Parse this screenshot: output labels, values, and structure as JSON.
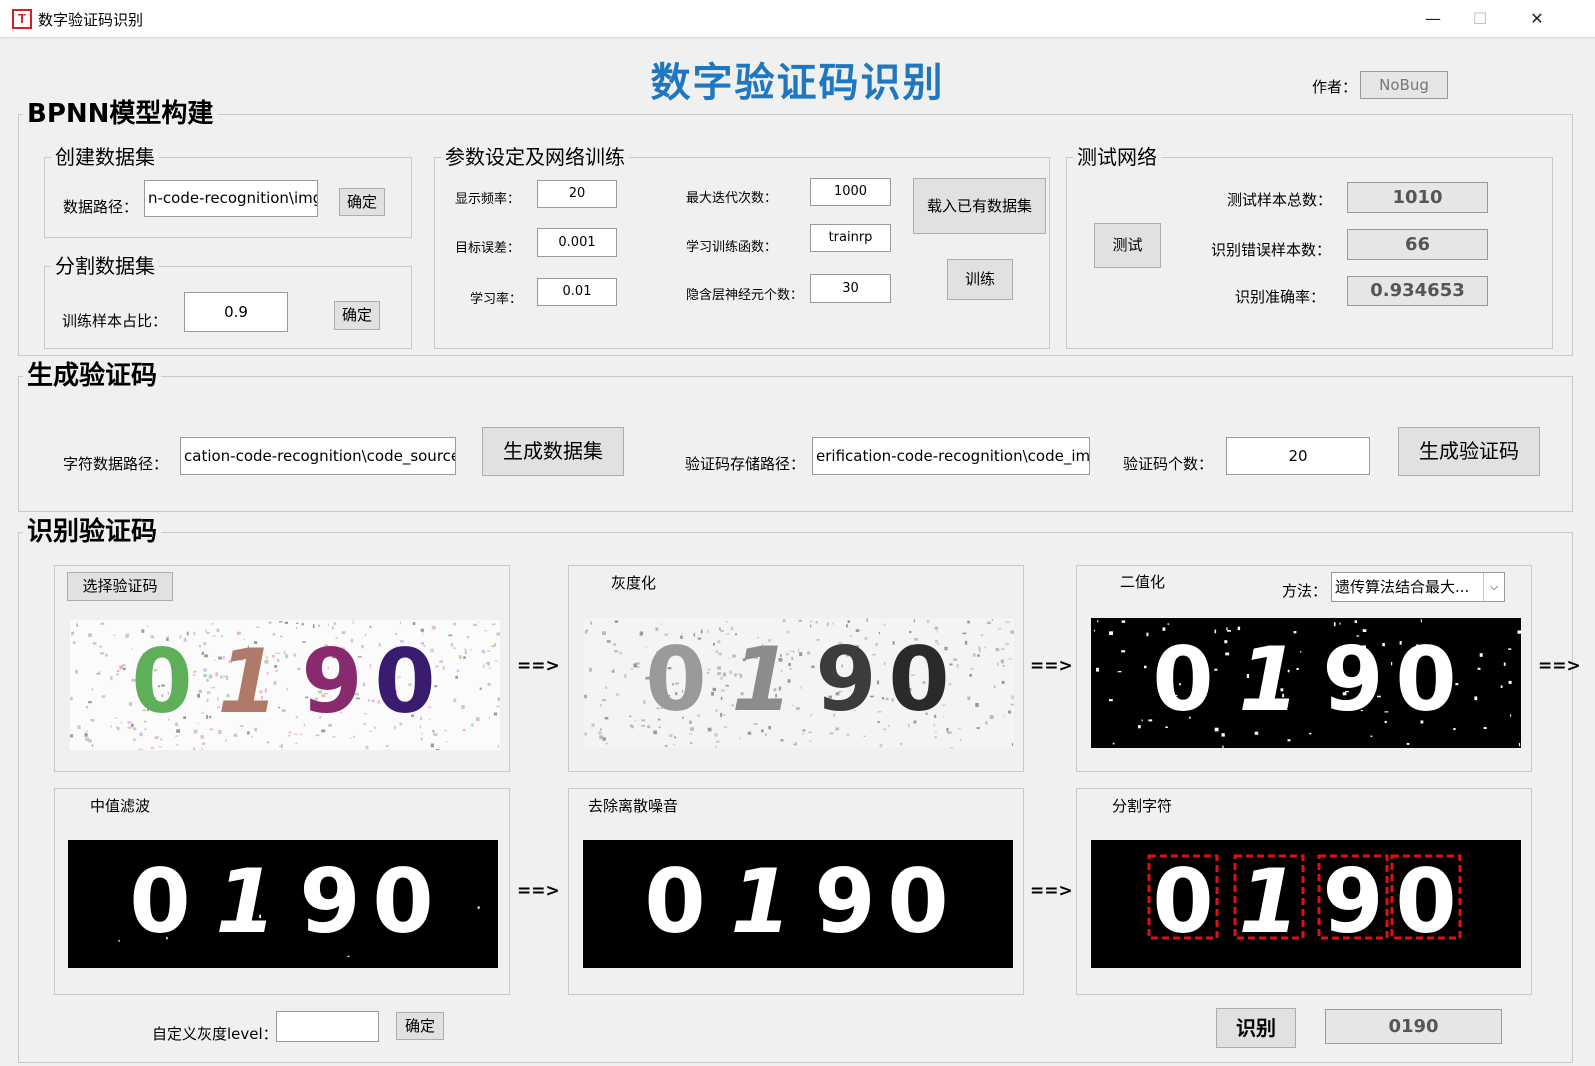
{
  "window": {
    "icon_letter": "T",
    "title": "数字验证码识别",
    "minimize_glyph": "—",
    "maximize_glyph": "☐",
    "close_glyph": "✕"
  },
  "header": {
    "title": "数字验证码识别",
    "author_label": "作者：",
    "author_value": "NoBug"
  },
  "bpnn": {
    "legend": "BPNN模型构建",
    "create_dataset": {
      "legend": "创建数据集",
      "path_label": "数据路径：",
      "path_value": "n-code-recognition\\img\\",
      "confirm": "确定"
    },
    "split_dataset": {
      "legend": "分割数据集",
      "ratio_label": "训练样本占比：",
      "ratio_value": "0.9",
      "confirm": "确定"
    },
    "params": {
      "legend": "参数设定及网络训练",
      "show_freq_label": "显示频率：",
      "show_freq_value": "20",
      "goal_label": "目标误差：",
      "goal_value": "0.001",
      "lr_label": "学习率：",
      "lr_value": "0.01",
      "max_epochs_label": "最大迭代次数：",
      "max_epochs_value": "1000",
      "train_fn_label": "学习训练函数：",
      "train_fn_value": "trainrp",
      "hidden_label": "隐含层神经元个数：",
      "hidden_value": "30",
      "load_button": "载入已有数据集",
      "train_button": "训练"
    },
    "test": {
      "legend": "测试网络",
      "test_button": "测试",
      "total_label": "测试样本总数：",
      "total_value": "1010",
      "errors_label": "识别错误样本数：",
      "errors_value": "66",
      "accuracy_label": "识别准确率：",
      "accuracy_value": "0.934653"
    }
  },
  "generate": {
    "legend": "生成验证码",
    "char_path_label": "字符数据路径：",
    "char_path_value": "cation-code-recognition\\code_source\\",
    "gen_dataset_button": "生成数据集",
    "code_path_label": "验证码存储路径：",
    "code_path_value": "erification-code-recognition\\code_img\\",
    "count_label": "验证码个数：",
    "count_value": "20",
    "gen_code_button": "生成验证码"
  },
  "recognize": {
    "legend": "识别验证码",
    "select_button": "选择验证码",
    "gray_title": "灰度化",
    "binary_title": "二值化",
    "method_label": "方法：",
    "method_value": "遗传算法结合最大...",
    "median_title": "中值滤波",
    "denoise_title": "去除离散噪音",
    "segment_title": "分割字符",
    "arrow": "==>",
    "captcha_digits": [
      "0",
      "1",
      "9",
      "0"
    ],
    "colors": {
      "digit_colors_original": [
        "#5fae5a",
        "#b07a6a",
        "#8a2a6e",
        "#3a1c6e"
      ],
      "gray_digit_colors": [
        "#9a9a9a",
        "#8c8c8c",
        "#3c3c3c",
        "#2a2a2a"
      ],
      "segment_box": "#e01010"
    },
    "custom_level_label": "自定义灰度level：",
    "custom_level_value": "",
    "custom_confirm": "确定",
    "recognize_button": "识别",
    "result_value": "0190"
  }
}
